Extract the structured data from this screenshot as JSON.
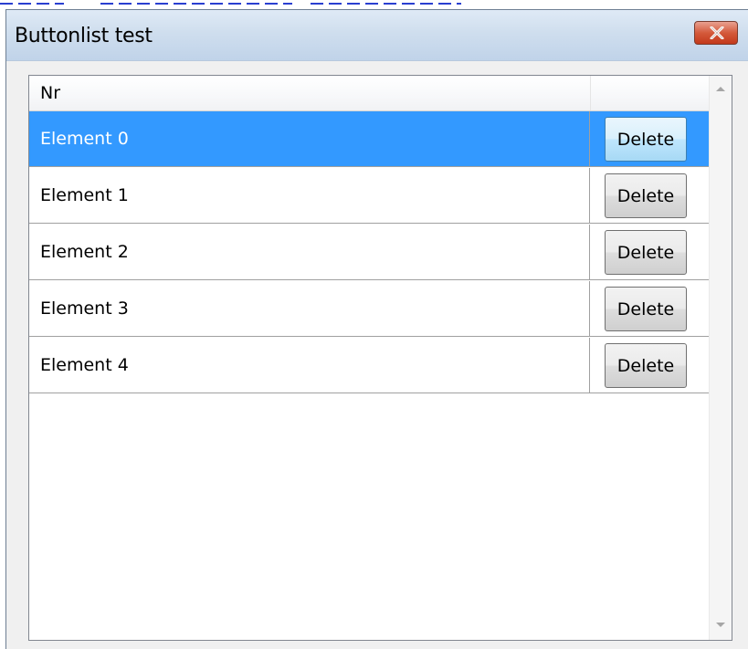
{
  "window": {
    "title": "Buttonlist test",
    "close_icon": "close-icon"
  },
  "list": {
    "column_header": "Nr",
    "action_header": "",
    "rows": [
      {
        "label": "Element 0",
        "button": "Delete",
        "selected": true
      },
      {
        "label": "Element 1",
        "button": "Delete",
        "selected": false
      },
      {
        "label": "Element 2",
        "button": "Delete",
        "selected": false
      },
      {
        "label": "Element 3",
        "button": "Delete",
        "selected": false
      },
      {
        "label": "Element 4",
        "button": "Delete",
        "selected": false
      }
    ]
  },
  "scrollbar": {
    "up_icon": "scroll-up-arrow-icon",
    "down_icon": "scroll-down-arrow-icon"
  },
  "colors": {
    "selection": "#3399ff",
    "close_button": "#c3391b",
    "titlebar": "#cfdeee"
  }
}
